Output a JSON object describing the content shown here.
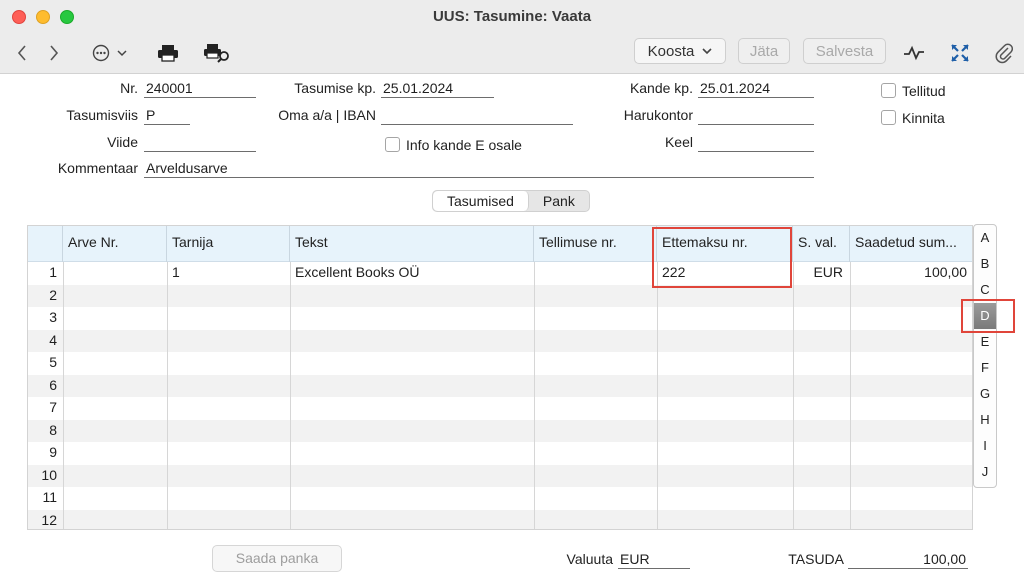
{
  "window": {
    "title": "UUS: Tasumine: Vaata"
  },
  "toolbar": {
    "koosta_label": "Koosta",
    "jata_label": "Jäta",
    "salvesta_label": "Salvesta"
  },
  "form": {
    "nr_label": "Nr.",
    "nr_value": "240001",
    "tasumise_kp_label": "Tasumise kp.",
    "tasumise_kp_value": "25.01.2024",
    "kande_kp_label": "Kande kp.",
    "kande_kp_value": "25.01.2024",
    "tellitud_label": "Tellitud",
    "tasumisviis_label": "Tasumisviis",
    "tasumisviis_value": "P",
    "oma_label": "Oma a/a | IBAN",
    "oma_value": "",
    "harukontor_label": "Harukontor",
    "harukontor_value": "",
    "kinnita_label": "Kinnita",
    "viide_label": "Viide",
    "viide_value": "",
    "info_label": "Info kande E osale",
    "keel_label": "Keel",
    "keel_value": "",
    "kommentaar_label": "Kommentaar",
    "kommentaar_value": "Arveldusarve"
  },
  "tabs": [
    {
      "label": "Tasumised",
      "active": true
    },
    {
      "label": "Pank",
      "active": false
    }
  ],
  "table": {
    "columns": [
      "",
      "Arve Nr.",
      "Tarnija",
      "Tekst",
      "Tellimuse nr.",
      "Ettemaksu nr.",
      "S. val.",
      "Saadetud sum..."
    ],
    "rows": [
      {
        "num": "1",
        "arve": "",
        "tarnija": "1",
        "tekst": "Excellent Books OÜ",
        "tellimuse": "",
        "ettemaksu": "222",
        "val": "EUR",
        "summa": "100,00"
      },
      {
        "num": "2",
        "arve": "",
        "tarnija": "",
        "tekst": "",
        "tellimuse": "",
        "ettemaksu": "",
        "val": "",
        "summa": ""
      },
      {
        "num": "3",
        "arve": "",
        "tarnija": "",
        "tekst": "",
        "tellimuse": "",
        "ettemaksu": "",
        "val": "",
        "summa": ""
      },
      {
        "num": "4",
        "arve": "",
        "tarnija": "",
        "tekst": "",
        "tellimuse": "",
        "ettemaksu": "",
        "val": "",
        "summa": ""
      },
      {
        "num": "5",
        "arve": "",
        "tarnija": "",
        "tekst": "",
        "tellimuse": "",
        "ettemaksu": "",
        "val": "",
        "summa": ""
      },
      {
        "num": "6",
        "arve": "",
        "tarnija": "",
        "tekst": "",
        "tellimuse": "",
        "ettemaksu": "",
        "val": "",
        "summa": ""
      },
      {
        "num": "7",
        "arve": "",
        "tarnija": "",
        "tekst": "",
        "tellimuse": "",
        "ettemaksu": "",
        "val": "",
        "summa": ""
      },
      {
        "num": "8",
        "arve": "",
        "tarnija": "",
        "tekst": "",
        "tellimuse": "",
        "ettemaksu": "",
        "val": "",
        "summa": ""
      },
      {
        "num": "9",
        "arve": "",
        "tarnija": "",
        "tekst": "",
        "tellimuse": "",
        "ettemaksu": "",
        "val": "",
        "summa": ""
      },
      {
        "num": "10",
        "arve": "",
        "tarnija": "",
        "tekst": "",
        "tellimuse": "",
        "ettemaksu": "",
        "val": "",
        "summa": ""
      },
      {
        "num": "11",
        "arve": "",
        "tarnija": "",
        "tekst": "",
        "tellimuse": "",
        "ettemaksu": "",
        "val": "",
        "summa": ""
      },
      {
        "num": "12",
        "arve": "",
        "tarnija": "",
        "tekst": "",
        "tellimuse": "",
        "ettemaksu": "",
        "val": "",
        "summa": ""
      }
    ]
  },
  "letters": [
    "A",
    "B",
    "C",
    "D",
    "E",
    "F",
    "G",
    "H",
    "I",
    "J"
  ],
  "active_letter": "D",
  "footer": {
    "saada_label": "Saada panka",
    "valuuta_label": "Valuuta",
    "valuuta_value": "EUR",
    "tasuda_label": "TASUDA",
    "tasuda_value": "100,00"
  },
  "colors": {
    "highlight": "#e0453a",
    "header_bg": "#e7f3fb"
  }
}
